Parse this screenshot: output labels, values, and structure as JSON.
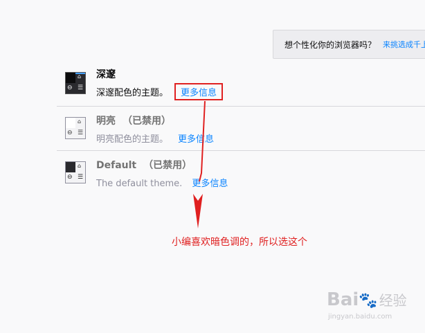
{
  "banner": {
    "question": "想个性化你的浏览器吗？",
    "link": "来挑选成千上"
  },
  "themes": [
    {
      "name": "深邃",
      "disabled_label": "",
      "description": "深邃配色的主题。",
      "more_info": "更多信息"
    },
    {
      "name": "明亮",
      "disabled_label": "（已禁用）",
      "description": "明亮配色的主题。",
      "more_info": "更多信息"
    },
    {
      "name": "Default",
      "disabled_label": "（已禁用）",
      "description": "The default theme.",
      "more_info": "更多信息"
    }
  ],
  "annotation": {
    "text": "小编喜欢暗色调的，所以选这个",
    "color": "#e02020"
  },
  "watermark": {
    "brand": "Bai",
    "suffix": "经验",
    "url": "jingyan.baidu.com"
  },
  "colors": {
    "accent": "#0a84ff",
    "highlight": "#e02020"
  },
  "icons": [
    "home-icon",
    "back-arrow-icon",
    "menu-icon"
  ]
}
